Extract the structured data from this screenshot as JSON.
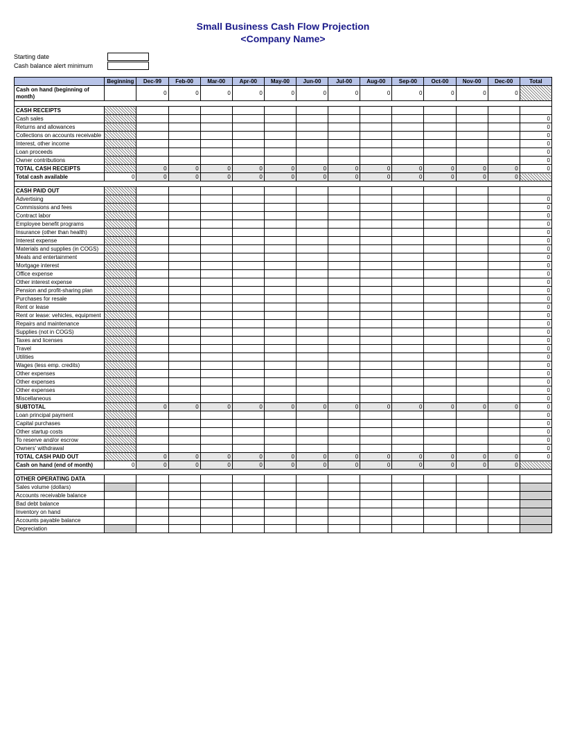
{
  "title": "Small Business Cash Flow Projection",
  "subtitle": "<Company Name>",
  "meta": {
    "starting_date_label": "Starting date",
    "cash_alert_label": "Cash balance alert minimum"
  },
  "columns": [
    "Beginning",
    "Dec-99",
    "Feb-00",
    "Mar-00",
    "Apr-00",
    "May-00",
    "Jun-00",
    "Jul-00",
    "Aug-00",
    "Sep-00",
    "Oct-00",
    "Nov-00",
    "Dec-00",
    "Total"
  ],
  "rows": {
    "cash_on_hand_begin": "Cash on hand (beginning of month)",
    "cash_receipts_head": "CASH RECEIPTS",
    "cash_sales": "Cash sales",
    "returns": "Returns and allowances",
    "collections": "Collections on accounts receivable",
    "interest_income": "Interest, other income",
    "loan_proceeds": "Loan proceeds",
    "owner_contrib": "Owner contributions",
    "total_receipts": "TOTAL CASH RECEIPTS",
    "total_cash_avail": "Total cash available",
    "cash_paid_head": "CASH PAID OUT",
    "advertising": "Advertising",
    "commissions": "Commissions and fees",
    "contract_labor": "Contract labor",
    "emp_benefit": "Employee benefit programs",
    "insurance": "Insurance (other than health)",
    "interest_exp": "Interest expense",
    "materials": "Materials and supplies (in COGS)",
    "meals": "Meals and entertainment",
    "mortgage": "Mortgage interest",
    "office": "Office expense",
    "other_interest": "Other interest expense",
    "pension": "Pension and profit-sharing plan",
    "purchases": "Purchases for resale",
    "rent": "Rent or lease",
    "rent_vehicles": "Rent or lease: vehicles, equipment",
    "repairs": "Repairs and maintenance",
    "supplies": "Supplies (not in COGS)",
    "taxes": "Taxes and licenses",
    "travel": "Travel",
    "utilities": "Utilities",
    "wages": "Wages (less emp. credits)",
    "other_exp1": "Other expenses",
    "other_exp2": "Other expenses",
    "other_exp3": "Other expenses",
    "misc": "Miscellaneous",
    "subtotal": "SUBTOTAL",
    "loan_principal": "Loan principal payment",
    "capital_purch": "Capital purchases",
    "startup": "Other startup costs",
    "reserve": "To reserve and/or escrow",
    "owners_withdraw": "Owners' withdrawal",
    "total_paid": "TOTAL CASH PAID OUT",
    "cash_on_hand_end": "Cash on hand (end of month)",
    "other_data_head": "OTHER OPERATING DATA",
    "sales_vol": "Sales volume (dollars)",
    "ar_balance": "Accounts receivable balance",
    "bad_debt": "Bad debt balance",
    "inventory": "Inventory on hand",
    "ap_balance": "Accounts payable balance",
    "depreciation": "Depreciation"
  },
  "zero": "0"
}
